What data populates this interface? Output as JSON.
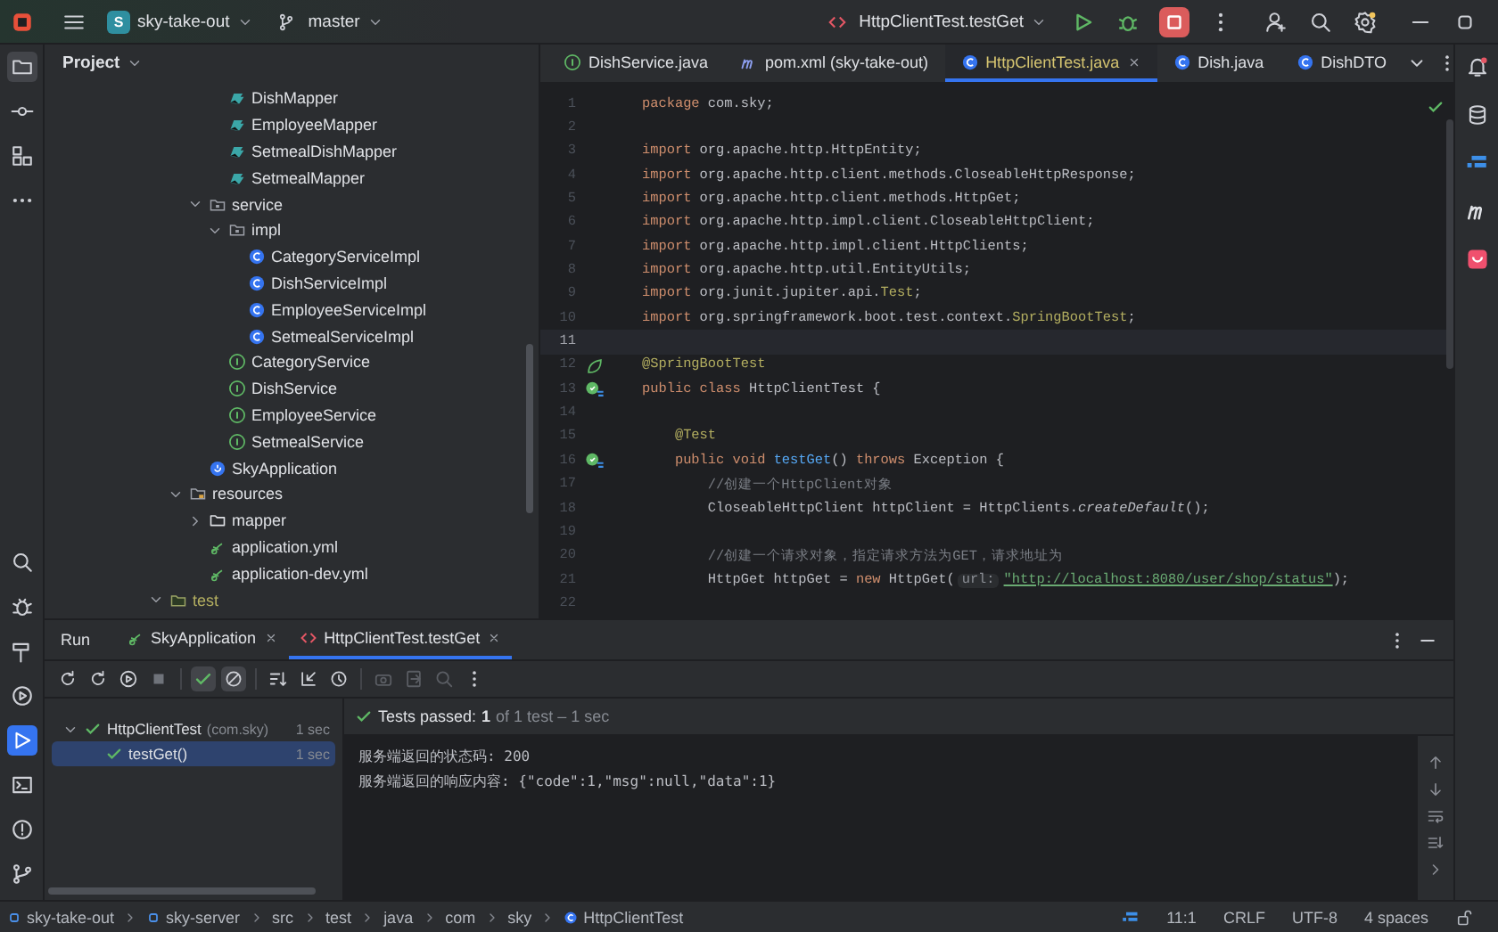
{
  "title_bar": {
    "project_badge": "S",
    "project": "sky-take-out",
    "branch": "master",
    "run_config": "HttpClientTest.testGet"
  },
  "left_toolbar": {
    "top": [
      {
        "kind": "folder",
        "selected": true
      },
      {
        "kind": "commit",
        "selected": false
      },
      {
        "kind": "structure",
        "selected": false
      },
      {
        "kind": "more",
        "selected": false
      }
    ],
    "bottom": [
      {
        "kind": "search",
        "selected": false
      },
      {
        "kind": "bug",
        "selected": false
      },
      {
        "kind": "hammer",
        "selected": false
      },
      {
        "kind": "services",
        "selected": false
      },
      {
        "kind": "run",
        "selected": true
      },
      {
        "kind": "terminal",
        "selected": false
      },
      {
        "kind": "problems",
        "selected": false
      },
      {
        "kind": "git",
        "selected": false
      }
    ]
  },
  "project_panel": {
    "title": "Project",
    "sections": [
      {
        "items": [
          {
            "label": "DishMapper",
            "kind": "mapper"
          },
          {
            "label": "EmployeeMapper",
            "kind": "mapper"
          },
          {
            "label": "SetmealDishMapper",
            "kind": "mapper"
          },
          {
            "label": "SetmealMapper",
            "kind": "mapper"
          }
        ]
      },
      {
        "items": [
          {
            "label": "service",
            "kind": "package",
            "expanded": true,
            "children": [
              {
                "label": "impl",
                "kind": "package",
                "expanded": true,
                "children": [
                  {
                    "label": "CategoryServiceImpl",
                    "kind": "class"
                  },
                  {
                    "label": "DishServiceImpl",
                    "kind": "class"
                  },
                  {
                    "label": "EmployeeServiceImpl",
                    "kind": "class"
                  },
                  {
                    "label": "SetmealServiceImpl",
                    "kind": "class"
                  }
                ]
              },
              {
                "label": "CategoryService",
                "kind": "interface"
              },
              {
                "label": "DishService",
                "kind": "interface"
              },
              {
                "label": "EmployeeService",
                "kind": "interface"
              },
              {
                "label": "SetmealService",
                "kind": "interface"
              }
            ]
          },
          {
            "label": "SkyApplication",
            "kind": "spring"
          }
        ]
      },
      {
        "items": [
          {
            "label": "resources",
            "kind": "resources",
            "expanded": true,
            "children": [
              {
                "label": "mapper",
                "kind": "folder",
                "expanded": false
              },
              {
                "label": "application.yml",
                "kind": "yml"
              },
              {
                "label": "application-dev.yml",
                "kind": "yml"
              }
            ]
          }
        ]
      },
      {
        "items": [
          {
            "label": "test",
            "kind": "test",
            "expanded": true
          }
        ]
      }
    ]
  },
  "editor_tabs": [
    {
      "label": "DishService.java",
      "kind": "interface",
      "selected": false
    },
    {
      "label": "pom.xml (sky-take-out)",
      "kind": "pom",
      "selected": false
    },
    {
      "label": "HttpClientTest.java",
      "kind": "class",
      "selected": true
    },
    {
      "label": "Dish.java",
      "kind": "class",
      "selected": false
    },
    {
      "label": "DishDTO",
      "kind": "class",
      "selected": false
    }
  ],
  "code_lines": [
    {
      "number": "1",
      "tokens": [
        {
          "kind": "kw",
          "s": "package"
        },
        {
          "kind": "plain",
          "s": " com.sky;"
        }
      ]
    },
    {
      "number": "2"
    },
    {
      "number": "3",
      "tokens": [
        {
          "kind": "kw",
          "s": "import"
        },
        {
          "kind": "plain",
          "s": " org.apache.http.HttpEntity;"
        }
      ]
    },
    {
      "number": "4",
      "tokens": [
        {
          "kind": "kw",
          "s": "import"
        },
        {
          "kind": "plain",
          "s": " org.apache.http.client.methods.CloseableHttpResponse;"
        }
      ]
    },
    {
      "number": "5",
      "tokens": [
        {
          "kind": "kw",
          "s": "import"
        },
        {
          "kind": "plain",
          "s": " org.apache.http.client.methods.HttpGet;"
        }
      ]
    },
    {
      "number": "6",
      "tokens": [
        {
          "kind": "kw",
          "s": "import"
        },
        {
          "kind": "plain",
          "s": " org.apache.http.impl.client.CloseableHttpClient;"
        }
      ]
    },
    {
      "number": "7",
      "tokens": [
        {
          "kind": "kw",
          "s": "import"
        },
        {
          "kind": "plain",
          "s": " org.apache.http.impl.client.HttpClients;"
        }
      ]
    },
    {
      "number": "8",
      "tokens": [
        {
          "kind": "kw",
          "s": "import"
        },
        {
          "kind": "plain",
          "s": " org.apache.http.util.EntityUtils;"
        }
      ]
    },
    {
      "number": "9",
      "tokens": [
        {
          "kind": "kw",
          "s": "import"
        },
        {
          "kind": "plain",
          "s": " org.junit.jupiter.api."
        },
        {
          "kind": "ann",
          "s": "Test"
        },
        {
          "kind": "plain",
          "s": ";"
        }
      ]
    },
    {
      "number": "10",
      "tokens": [
        {
          "kind": "kw",
          "s": "import"
        },
        {
          "kind": "plain",
          "s": " org.springframework.boot.test.context."
        },
        {
          "kind": "ann",
          "s": "SpringBootTest"
        },
        {
          "kind": "plain",
          "s": ";"
        }
      ]
    },
    {
      "number": "11",
      "current": true
    },
    {
      "number": "12",
      "gutter": {
        "kind": "bean"
      },
      "tokens": [
        {
          "kind": "ann",
          "s": "@SpringBootTest"
        }
      ]
    },
    {
      "number": "13",
      "gutter": {
        "kind": "run"
      },
      "tokens": [
        {
          "kind": "kw",
          "s": "public class"
        },
        {
          "kind": "plain",
          "s": " HttpClientTest {"
        }
      ]
    },
    {
      "number": "14"
    },
    {
      "number": "15",
      "tokens": [
        {
          "kind": "ann",
          "s": "    @Test"
        }
      ]
    },
    {
      "number": "16",
      "gutter": {
        "kind": "run"
      },
      "tokens": [
        {
          "kind": "kw",
          "s": "    public void "
        },
        {
          "kind": "method",
          "s": "testGet"
        },
        {
          "kind": "plain",
          "s": "() "
        },
        {
          "kind": "kw",
          "s": "throws"
        },
        {
          "kind": "plain",
          "s": " Exception {"
        }
      ]
    },
    {
      "number": "17",
      "tokens": [
        {
          "kind": "comment",
          "s": "        //创建一个HttpClient对象"
        }
      ]
    },
    {
      "number": "18",
      "tokens": [
        {
          "kind": "plain",
          "s": "        CloseableHttpClient httpClient = HttpClients."
        },
        {
          "kind": "italic",
          "s": "createDefault"
        },
        {
          "kind": "plain",
          "s": "();"
        }
      ]
    },
    {
      "number": "19"
    },
    {
      "number": "20",
      "tokens": [
        {
          "kind": "comment",
          "s": "        //创建一个请求对象，指定请求方法为GET，请求地址为"
        }
      ]
    },
    {
      "number": "21",
      "tokens": [
        {
          "kind": "plain",
          "s": "        HttpGet httpGet = "
        },
        {
          "kind": "kw",
          "s": "new"
        },
        {
          "kind": "plain",
          "s": " HttpGet("
        },
        {
          "kind": "hint",
          "s": "url:"
        },
        {
          "kind": "str",
          "s": "\"http://localhost:8080/user/shop/status\""
        },
        {
          "kind": "plain",
          "s": ");"
        }
      ]
    },
    {
      "number": "22"
    }
  ],
  "run_panel": {
    "title": "Run",
    "tabs": [
      {
        "label": "SkyApplication",
        "kind": "spring",
        "selected": false
      },
      {
        "label": "HttpClientTest.testGet",
        "kind": "test",
        "selected": true
      }
    ],
    "test_tree": [
      {
        "label": "HttpClientTest",
        "package": "(com.sky)",
        "time": "1 sec",
        "passed": true,
        "selected": false,
        "expanded": true,
        "children": [
          {
            "label": "testGet()",
            "time": "1 sec",
            "passed": true,
            "selected": true
          }
        ]
      }
    ],
    "summary": {
      "label": "Tests passed:",
      "count": "1",
      "detail": "of 1 test – 1 sec"
    },
    "console": [
      "服务端返回的状态码: 200",
      "服务端返回的响应内容: {\"code\":1,\"msg\":null,\"data\":1}"
    ]
  },
  "status_bar": {
    "breadcrumbs": [
      "sky-take-out",
      "sky-server",
      "src",
      "test",
      "java",
      "com",
      "sky",
      "HttpClientTest"
    ],
    "position": "11:1",
    "line_ending": "CRLF",
    "encoding": "UTF-8",
    "indent": "4 spaces"
  }
}
